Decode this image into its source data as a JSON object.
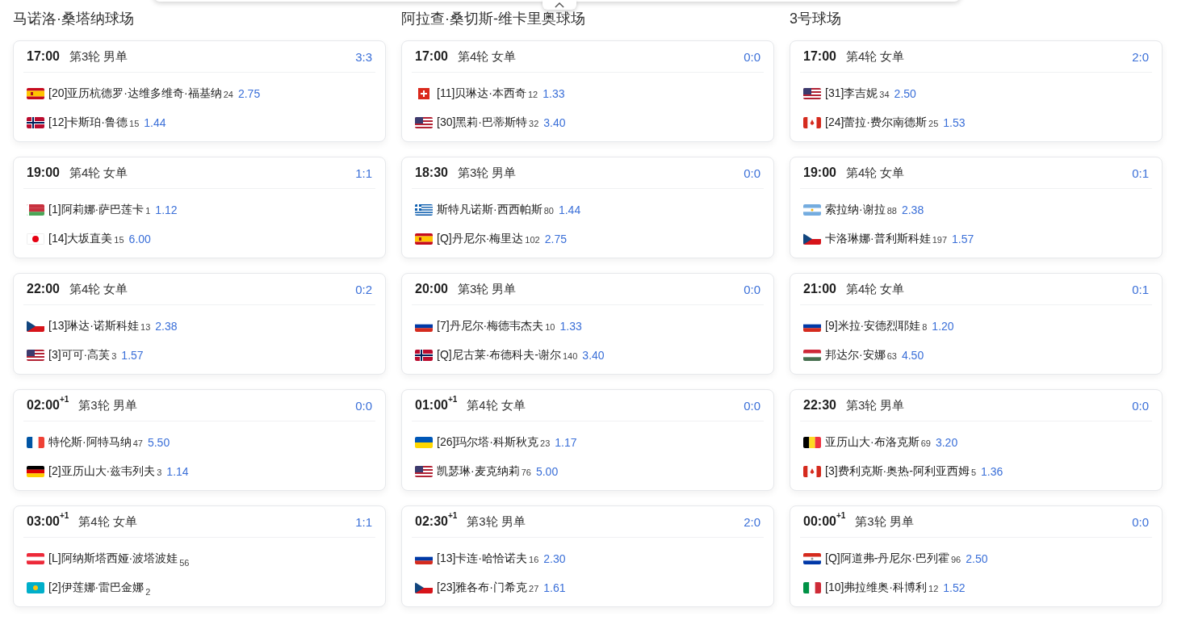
{
  "courts": [
    {
      "name": "马诺洛·桑塔纳球场",
      "matches": [
        {
          "time": "17:00",
          "round": "第3轮 男单",
          "score": "3:3",
          "players": [
            {
              "kind": "es",
              "name": "[20]亚历杭德罗·达维多维奇·福基纳",
              "rank": "24",
              "odds": "2.75"
            },
            {
              "kind": "no",
              "name": "[12]卡斯珀·鲁德",
              "rank": "15",
              "odds": "1.44"
            }
          ]
        },
        {
          "time": "19:00",
          "round": "第4轮 女单",
          "score": "1:1",
          "players": [
            {
              "kind": "by",
              "name": "[1]阿莉娜·萨巴莲卡",
              "rank": "1",
              "odds": "1.12"
            },
            {
              "kind": "jp",
              "name": "[14]大坂直美",
              "rank": "15",
              "odds": "6.00"
            }
          ]
        },
        {
          "time": "22:00",
          "round": "第4轮 女单",
          "score": "0:2",
          "players": [
            {
              "kind": "cz",
              "name": "[13]琳达·诺斯科娃",
              "rank": "13",
              "odds": "2.38"
            },
            {
              "kind": "us",
              "name": "[3]可可·高芙",
              "rank": "3",
              "odds": "1.57"
            }
          ]
        },
        {
          "time": "02:00",
          "day_offset": "+1",
          "round": "第3轮 男单",
          "score": "0:0",
          "players": [
            {
              "kind": "fr",
              "name": "特伦斯·阿特马纳",
              "rank": "47",
              "odds": "5.50"
            },
            {
              "kind": "de",
              "name": "[2]亚历山大·兹韦列夫",
              "rank": "3",
              "odds": "1.14"
            }
          ]
        },
        {
          "time": "03:00",
          "day_offset": "+1",
          "round": "第4轮 女单",
          "score": "1:1",
          "players": [
            {
              "kind": "at",
              "name": "[L]阿纳斯塔西娅·波塔波娃",
              "rank": "56"
            },
            {
              "kind": "kz",
              "name": "[2]伊莲娜·雷巴金娜",
              "rank": "2"
            }
          ]
        }
      ]
    },
    {
      "name": "阿拉查·桑切斯-维卡里奥球场",
      "matches": [
        {
          "time": "17:00",
          "round": "第4轮 女单",
          "score": "0:0",
          "players": [
            {
              "kind": "ch",
              "name": "[11]贝琳达·本西奇",
              "rank": "12",
              "odds": "1.33"
            },
            {
              "kind": "us",
              "name": "[30]黑莉·巴蒂斯特",
              "rank": "32",
              "odds": "3.40"
            }
          ]
        },
        {
          "time": "18:30",
          "round": "第3轮 男单",
          "score": "0:0",
          "players": [
            {
              "kind": "gr",
              "name": "斯特凡诺斯·西西帕斯",
              "rank": "80",
              "odds": "1.44"
            },
            {
              "kind": "es",
              "name": "[Q]丹尼尔·梅里达",
              "rank": "102",
              "odds": "2.75"
            }
          ]
        },
        {
          "time": "20:00",
          "round": "第3轮 男单",
          "score": "0:0",
          "players": [
            {
              "kind": "ru",
              "name": "[7]丹尼尔·梅德韦杰夫",
              "rank": "10",
              "odds": "1.33"
            },
            {
              "kind": "no",
              "name": "[Q]尼古莱·布德科夫-谢尔",
              "rank": "140",
              "odds": "3.40"
            }
          ]
        },
        {
          "time": "01:00",
          "day_offset": "+1",
          "round": "第4轮 女单",
          "score": "0:0",
          "players": [
            {
              "kind": "ua",
              "name": "[26]玛尔塔·科斯秋克",
              "rank": "23",
              "odds": "1.17"
            },
            {
              "kind": "us",
              "name": "凯瑟琳·麦克纳莉",
              "rank": "76",
              "odds": "5.00"
            }
          ]
        },
        {
          "time": "02:30",
          "day_offset": "+1",
          "round": "第3轮 男单",
          "score": "2:0",
          "players": [
            {
              "kind": "ru",
              "name": "[13]卡连·哈恰诺夫",
              "rank": "16",
              "odds": "2.30"
            },
            {
              "kind": "cz",
              "name": "[23]雅各布·门希克",
              "rank": "27",
              "odds": "1.61"
            }
          ]
        }
      ]
    },
    {
      "name": "3号球场",
      "matches": [
        {
          "time": "17:00",
          "round": "第4轮 女单",
          "score": "2:0",
          "players": [
            {
              "kind": "us",
              "name": "[31]李吉妮",
              "rank": "34",
              "odds": "2.50"
            },
            {
              "kind": "ca",
              "name": "[24]蕾拉·费尔南德斯",
              "rank": "25",
              "odds": "1.53"
            }
          ]
        },
        {
          "time": "19:00",
          "round": "第4轮 女单",
          "score": "0:1",
          "players": [
            {
              "kind": "ar",
              "name": "索拉纳·谢拉",
              "rank": "88",
              "odds": "2.38"
            },
            {
              "kind": "cz",
              "name": "卡洛琳娜·普利斯科娃",
              "rank": "197",
              "odds": "1.57"
            }
          ]
        },
        {
          "time": "21:00",
          "round": "第4轮 女单",
          "score": "0:1",
          "players": [
            {
              "kind": "ru",
              "name": "[9]米拉·安德烈耶娃",
              "rank": "8",
              "odds": "1.20"
            },
            {
              "kind": "hu",
              "name": "邦达尔·安娜",
              "rank": "63",
              "odds": "4.50"
            }
          ]
        },
        {
          "time": "22:30",
          "round": "第3轮 男单",
          "score": "0:0",
          "players": [
            {
              "kind": "be",
              "name": "亚历山大·布洛克斯",
              "rank": "69",
              "odds": "3.20"
            },
            {
              "kind": "ca",
              "name": "[3]费利克斯·奥热-阿利亚西姆",
              "rank": "5",
              "odds": "1.36"
            }
          ]
        },
        {
          "time": "00:00",
          "day_offset": "+1",
          "round": "第3轮 男单",
          "score": "0:0",
          "players": [
            {
              "kind": "py",
              "name": "[Q]阿道弗-丹尼尔·巴列霍",
              "rank": "96",
              "odds": "2.50"
            },
            {
              "kind": "it",
              "name": "[10]弗拉维奥·科博利",
              "rank": "12",
              "odds": "1.52"
            }
          ]
        }
      ]
    }
  ]
}
